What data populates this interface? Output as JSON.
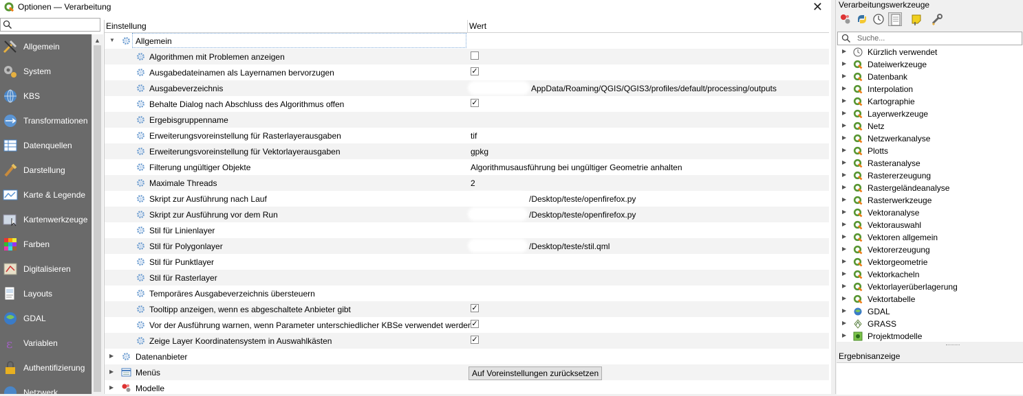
{
  "window": {
    "title": "Optionen — Verarbeitung",
    "close_glyph": "✕"
  },
  "sidebar": {
    "search_placeholder": "",
    "items": [
      {
        "label": "Allgemein",
        "icon": "tools-icon"
      },
      {
        "label": "System",
        "icon": "system-gears-icon"
      },
      {
        "label": "KBS",
        "icon": "globe-icon"
      },
      {
        "label": "Transformationen",
        "icon": "globe-transform-icon"
      },
      {
        "label": "Datenquellen",
        "icon": "table-icon"
      },
      {
        "label": "Darstellung",
        "icon": "brush-icon"
      },
      {
        "label": "Karte & Legende",
        "icon": "map-icon"
      },
      {
        "label": "Kartenwerkzeuge",
        "icon": "map-tool-icon"
      },
      {
        "label": "Farben",
        "icon": "palette-icon"
      },
      {
        "label": "Digitalisieren",
        "icon": "digitize-icon"
      },
      {
        "label": "Layouts",
        "icon": "layout-icon"
      },
      {
        "label": "GDAL",
        "icon": "gdal-icon"
      },
      {
        "label": "Variablen",
        "icon": "variable-icon"
      },
      {
        "label": "Authentifizierung",
        "icon": "lock-icon"
      },
      {
        "label": "Netzwerk",
        "icon": "network-icon"
      }
    ]
  },
  "table": {
    "col_setting": "Einstellung",
    "col_value": "Wert",
    "group_general": "Allgemein",
    "settings": [
      {
        "name": "Algorithmen mit Problemen anzeigen",
        "type": "check",
        "checked": false
      },
      {
        "name": "Ausgabedateinamen als Layernamen bervorzugen",
        "type": "check",
        "checked": true
      },
      {
        "name": "Ausgabeverzeichnis",
        "type": "text",
        "value": "AppData/Roaming/QGIS/QGIS3/profiles/default/processing/outputs"
      },
      {
        "name": "Behalte Dialog nach Abschluss des Algorithmus offen",
        "type": "check",
        "checked": true
      },
      {
        "name": "Ergebisgruppenname",
        "type": "text",
        "value": ""
      },
      {
        "name": "Erweiterungsvoreinstellung für Rasterlayerausgaben",
        "type": "text",
        "value": "tif"
      },
      {
        "name": "Erweiterungsvoreinstellung für Vektorlayerausgaben",
        "type": "text",
        "value": "gpkg"
      },
      {
        "name": "Filterung ungültiger Objekte",
        "type": "text",
        "value": "Algorithmusausführung bei ungültiger Geometrie anhalten"
      },
      {
        "name": "Maximale Threads",
        "type": "text",
        "value": "2"
      },
      {
        "name": "Skript zur Ausführung nach Lauf",
        "type": "text",
        "value": "/Desktop/teste/openfirefox.py"
      },
      {
        "name": "Skript zur Ausführung vor dem Run",
        "type": "text",
        "value": "/Desktop/teste/openfirefox.py"
      },
      {
        "name": "Stil für Linienlayer",
        "type": "text",
        "value": ""
      },
      {
        "name": "Stil für Polygonlayer",
        "type": "text",
        "value": "/Desktop/teste/stil.qml"
      },
      {
        "name": "Stil für Punktlayer",
        "type": "text",
        "value": ""
      },
      {
        "name": "Stil für Rasterlayer",
        "type": "text",
        "value": ""
      },
      {
        "name": "Temporäres Ausgabeverzeichnis übersteuern",
        "type": "text",
        "value": ""
      },
      {
        "name": "Tooltipp anzeigen, wenn es abgeschaltete Anbieter gibt",
        "type": "check",
        "checked": true
      },
      {
        "name": "Vor der Ausführung warnen, wenn Parameter unterschiedlicher KBSe verwendet werden",
        "type": "check",
        "checked": true
      },
      {
        "name": "Zeige Layer Koordinatensystem in Auswahlkästen",
        "type": "check",
        "checked": true
      }
    ],
    "groups_after": [
      {
        "name": "Datenanbieter",
        "icon": "gear-icon"
      },
      {
        "name": "Menüs",
        "icon": "menu-icon"
      },
      {
        "name": "Modelle",
        "icon": "models-icon"
      }
    ],
    "reset_button": "Auf Voreinstellungen zurücksetzen",
    "check_glyph": "✓"
  },
  "panel": {
    "title": "Verarbeitungswerkzeuge",
    "search_placeholder": "Suche...",
    "toolbar": [
      "models-icon",
      "python-icon",
      "history-icon",
      "results-icon",
      "edit-features-icon",
      "options-icon"
    ],
    "tree": [
      {
        "label": "Kürzlich verwendet",
        "icon": "clock-icon"
      },
      {
        "label": "Dateiwerkzeuge",
        "icon": "qgis-icon"
      },
      {
        "label": "Datenbank",
        "icon": "qgis-icon"
      },
      {
        "label": "Interpolation",
        "icon": "qgis-icon"
      },
      {
        "label": "Kartographie",
        "icon": "qgis-icon"
      },
      {
        "label": "Layerwerkzeuge",
        "icon": "qgis-icon"
      },
      {
        "label": "Netz",
        "icon": "qgis-icon"
      },
      {
        "label": "Netzwerkanalyse",
        "icon": "qgis-icon"
      },
      {
        "label": "Plotts",
        "icon": "qgis-icon"
      },
      {
        "label": "Rasteranalyse",
        "icon": "qgis-icon"
      },
      {
        "label": "Rastererzeugung",
        "icon": "qgis-icon"
      },
      {
        "label": "Rastergeländeanalyse",
        "icon": "qgis-icon"
      },
      {
        "label": "Rasterwerkzeuge",
        "icon": "qgis-icon"
      },
      {
        "label": "Vektoranalyse",
        "icon": "qgis-icon"
      },
      {
        "label": "Vektorauswahl",
        "icon": "qgis-icon"
      },
      {
        "label": "Vektoren allgemein",
        "icon": "qgis-icon"
      },
      {
        "label": "Vektorerzeugung",
        "icon": "qgis-icon"
      },
      {
        "label": "Vektorgeometrie",
        "icon": "qgis-icon"
      },
      {
        "label": "Vektorkacheln",
        "icon": "qgis-icon"
      },
      {
        "label": "Vektorlayerüberlagerung",
        "icon": "qgis-icon"
      },
      {
        "label": "Vektortabelle",
        "icon": "qgis-icon"
      },
      {
        "label": "GDAL",
        "icon": "gdal-icon"
      },
      {
        "label": "GRASS",
        "icon": "grass-icon"
      },
      {
        "label": "Projektmodelle",
        "icon": "project-models-icon"
      }
    ],
    "results_title": "Ergebnisanzeige"
  }
}
